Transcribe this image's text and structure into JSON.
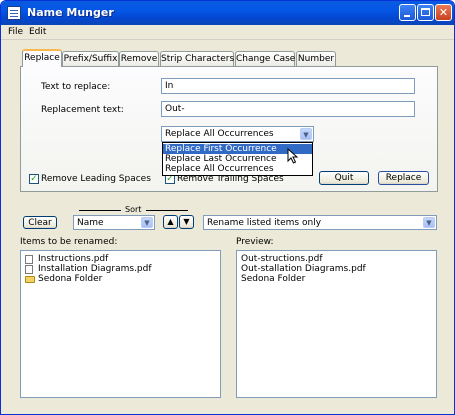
{
  "window": {
    "title": "Name Munger"
  },
  "menu": {
    "items": [
      "File",
      "Edit"
    ]
  },
  "tabs": [
    "Replace",
    "Prefix/Suffix",
    "Remove",
    "Strip Characters",
    "Change Case",
    "Number"
  ],
  "replace_tab": {
    "text_to_replace_label": "Text to replace:",
    "text_to_replace_value": "In",
    "replacement_text_label": "Replacement text:",
    "replacement_text_value": "Out-",
    "mode_selected": "Replace All Occurrences",
    "mode_options": [
      "Replace First Occurrence",
      "Replace Last Occurrence",
      "Replace All Occurrences"
    ],
    "highlighted_option": "Replace First Occurrence",
    "remove_leading_label": "Remove Leading Spaces",
    "remove_leading_checked": true,
    "remove_trailing_label": "Remove Trailing Spaces",
    "remove_trailing_checked": true,
    "quit_label": "Quit",
    "replace_label": "Replace"
  },
  "controls": {
    "clear_label": "Clear",
    "sort_label": "Sort",
    "sort_value": "Name",
    "up_glyph": "▲",
    "down_glyph": "▼",
    "rename_mode_value": "Rename listed items only"
  },
  "items_list": {
    "label": "Items to be renamed:",
    "items": [
      {
        "name": "Instructions.pdf",
        "icon": "file-icon"
      },
      {
        "name": "Installation Diagrams.pdf",
        "icon": "file-icon"
      },
      {
        "name": "Sedona Folder",
        "icon": "folder-icon"
      }
    ]
  },
  "preview_list": {
    "label": "Preview:",
    "items": [
      "Out-structions.pdf",
      "Out-stallation Diagrams.pdf",
      "Sedona Folder"
    ]
  }
}
